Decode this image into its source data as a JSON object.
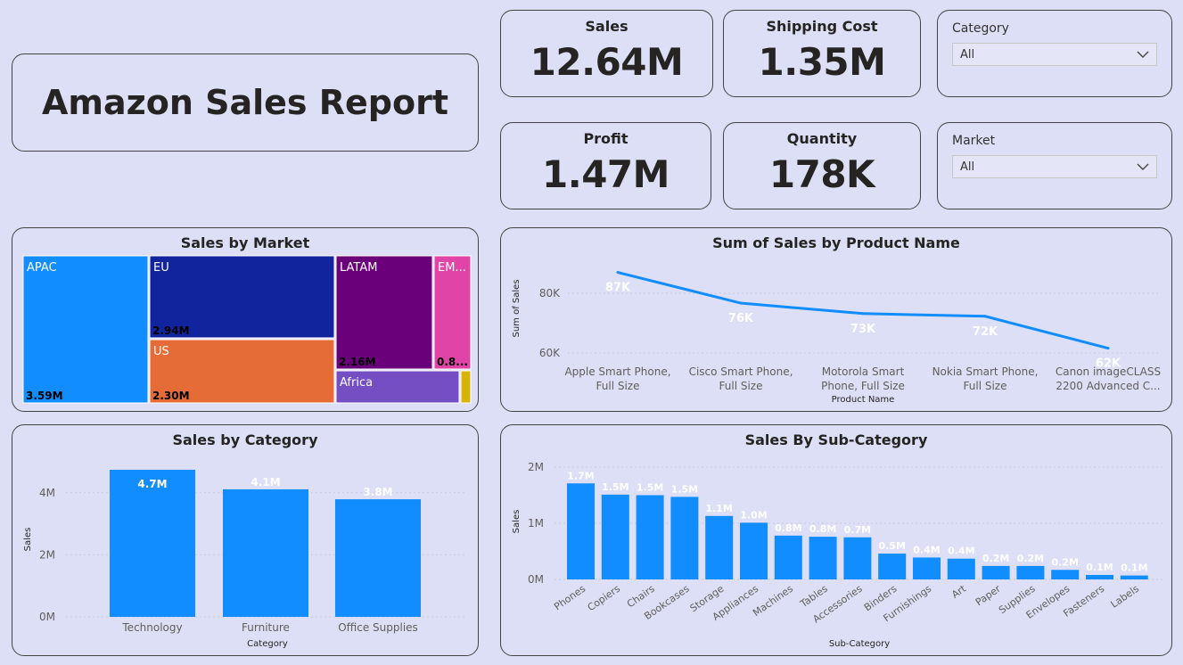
{
  "report": {
    "title": "Amazon Sales Report"
  },
  "kpis": {
    "sales": {
      "label": "Sales",
      "value": "12.64M"
    },
    "shipping": {
      "label": "Shipping Cost",
      "value": "1.35M"
    },
    "profit": {
      "label": "Profit",
      "value": "1.47M"
    },
    "quantity": {
      "label": "Quantity",
      "value": "178K"
    }
  },
  "slicers": {
    "category": {
      "label": "Category",
      "value": "All"
    },
    "market": {
      "label": "Market",
      "value": "All"
    }
  },
  "colors": {
    "primary": "#118dff",
    "apac": "#118dff",
    "eu": "#12239e",
    "us": "#e66c37",
    "latam": "#6b007b",
    "emea": "#e044a7",
    "africa": "#744ec2",
    "canada": "#d9b300"
  },
  "chart_data": [
    {
      "id": "market",
      "type": "treemap",
      "title": "Sales by Market",
      "items": [
        {
          "name": "APAC",
          "label": "APAC",
          "value_label": "3.59M",
          "value": 3.59
        },
        {
          "name": "EU",
          "label": "EU",
          "value_label": "2.94M",
          "value": 2.94
        },
        {
          "name": "US",
          "label": "US",
          "value_label": "2.30M",
          "value": 2.3
        },
        {
          "name": "LATAM",
          "label": "LATAM",
          "value_label": "2.16M",
          "value": 2.16
        },
        {
          "name": "EMEA",
          "label": "EM...",
          "value_label": "0.8...",
          "value": 0.81
        },
        {
          "name": "Africa",
          "label": "Africa",
          "value_label": "",
          "value": 0.78
        },
        {
          "name": "Canada",
          "label": "",
          "value_label": "",
          "value": 0.07
        }
      ]
    },
    {
      "id": "product",
      "type": "line",
      "title": "Sum of Sales by Product Name",
      "xlabel": "Product Name",
      "ylabel": "Sum of Sales",
      "categories": [
        [
          "Apple Smart Phone,",
          "Full Size"
        ],
        [
          "Cisco Smart Phone,",
          "Full Size"
        ],
        [
          "Motorola Smart",
          "Phone, Full Size"
        ],
        [
          "Nokia Smart Phone,",
          "Full Size"
        ],
        [
          "Canon imageCLASS",
          "2200 Advanced C..."
        ]
      ],
      "values": [
        87000,
        76700,
        73200,
        72300,
        61600
      ],
      "data_labels": [
        "87K",
        "76K",
        "73K",
        "72K",
        "62K"
      ],
      "yticks": [
        {
          "v": 60000,
          "label": "60K"
        },
        {
          "v": 80000,
          "label": "80K"
        }
      ],
      "ylim": [
        57000,
        91000
      ]
    },
    {
      "id": "category",
      "type": "bar",
      "title": "Sales by Category",
      "xlabel": "Category",
      "ylabel": "Sales",
      "categories": [
        "Technology",
        "Furniture",
        "Office Supplies"
      ],
      "values": [
        4.74,
        4.11,
        3.79
      ],
      "data_labels": [
        "4.7M",
        "4.1M",
        "3.8M"
      ],
      "yticks": [
        {
          "v": 0,
          "label": "0M"
        },
        {
          "v": 2,
          "label": "2M"
        },
        {
          "v": 4,
          "label": "4M"
        }
      ],
      "ylim": [
        0,
        4.74
      ]
    },
    {
      "id": "subcategory",
      "type": "bar",
      "title": "Sales By Sub-Category",
      "xlabel": "Sub-Category",
      "ylabel": "Sales",
      "categories": [
        "Phones",
        "Copiers",
        "Chairs",
        "Bookcases",
        "Storage",
        "Appliances",
        "Machines",
        "Tables",
        "Accessories",
        "Binders",
        "Furnishings",
        "Art",
        "Paper",
        "Supplies",
        "Envelopes",
        "Fasteners",
        "Labels"
      ],
      "values": [
        1.71,
        1.51,
        1.5,
        1.47,
        1.13,
        1.01,
        0.78,
        0.76,
        0.75,
        0.46,
        0.39,
        0.37,
        0.24,
        0.24,
        0.17,
        0.08,
        0.07
      ],
      "data_labels": [
        "1.7M",
        "1.5M",
        "1.5M",
        "1.5M",
        "1.1M",
        "1.0M",
        "0.8M",
        "0.8M",
        "0.7M",
        "0.5M",
        "0.4M",
        "0.4M",
        "0.2M",
        "0.2M",
        "0.2M",
        "0.1M",
        "0.1M"
      ],
      "yticks": [
        {
          "v": 0,
          "label": "0M"
        },
        {
          "v": 1,
          "label": "1M"
        },
        {
          "v": 2,
          "label": "2M"
        }
      ],
      "ylim": [
        0,
        2
      ]
    }
  ]
}
